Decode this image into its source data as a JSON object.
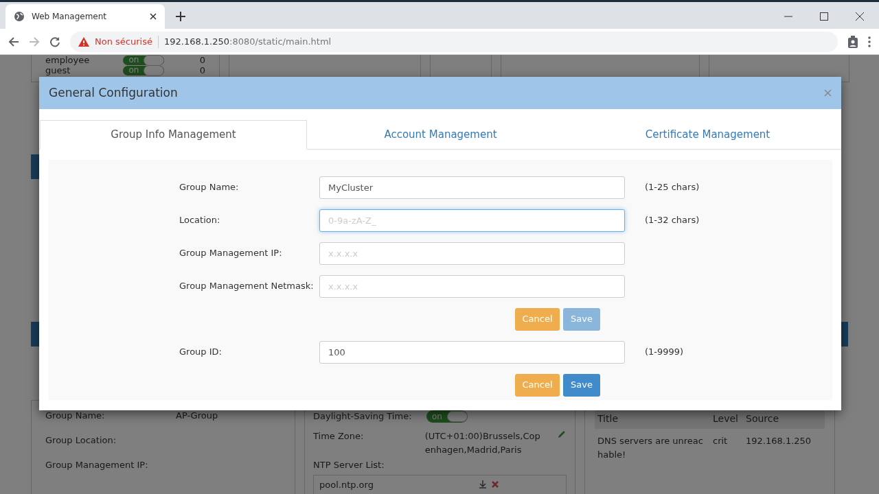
{
  "browser": {
    "tab_title": "Web Management",
    "security_label": "Non sécurisé",
    "url_host": "192.168.1.250",
    "url_rest": ":8080/static/main.html"
  },
  "background": {
    "user_groups": [
      {
        "name": "employee",
        "toggle_label": "on",
        "on": true,
        "count": "0"
      },
      {
        "name": "guest",
        "toggle_label": "on",
        "on": true,
        "count": "0"
      }
    ],
    "group_info": [
      {
        "label": "Group Name:",
        "value": "AP-Group"
      },
      {
        "label": "Group Location:"
      },
      {
        "label": "Group Management IP:"
      }
    ],
    "time": {
      "dst_label": "Daylight-Saving Time:",
      "dst_toggle": "on",
      "dst_on": true,
      "tz_label": "Time Zone:",
      "tz_value": "(UTC+01:00)Brussels,Copenhagen,Madrid,Paris",
      "ntp_label": "NTP Server List:",
      "ntp_servers": [
        "pool.ntp.org"
      ]
    },
    "alerts": {
      "columns": [
        "Title",
        "Level",
        "Source"
      ],
      "rows": [
        [
          "DNS servers are unreachable!",
          "crit",
          "192.168.1.250"
        ]
      ]
    }
  },
  "modal": {
    "title": "General Configuration",
    "tabs": [
      {
        "label": "Group Info Management",
        "selected": true
      },
      {
        "label": "Account Management",
        "selected": false
      },
      {
        "label": "Certificate Management",
        "selected": false
      }
    ],
    "rows": [
      {
        "kind": "field",
        "label": "Group Name:",
        "value": "MyCluster",
        "hint": "(1-25 chars)",
        "focused": false
      },
      {
        "kind": "field",
        "label": "Location:",
        "placeholder": "0-9a-zA-Z_",
        "hint": "(1-32 chars)",
        "focused": true
      },
      {
        "kind": "field",
        "label": "Group Management IP:",
        "placeholder": "x.x.x.x",
        "focused": false
      },
      {
        "kind": "field",
        "label": "Group Management Netmask:",
        "placeholder": "x.x.x.x",
        "focused": false
      },
      {
        "kind": "actions",
        "cancel": "Cancel",
        "save": "Save",
        "disabled": true
      },
      {
        "kind": "field",
        "label": "Group ID:",
        "value": "100",
        "hint": "(1-9999)",
        "focused": false
      },
      {
        "kind": "actions",
        "cancel": "Cancel",
        "save": "Save",
        "disabled": false
      }
    ]
  }
}
